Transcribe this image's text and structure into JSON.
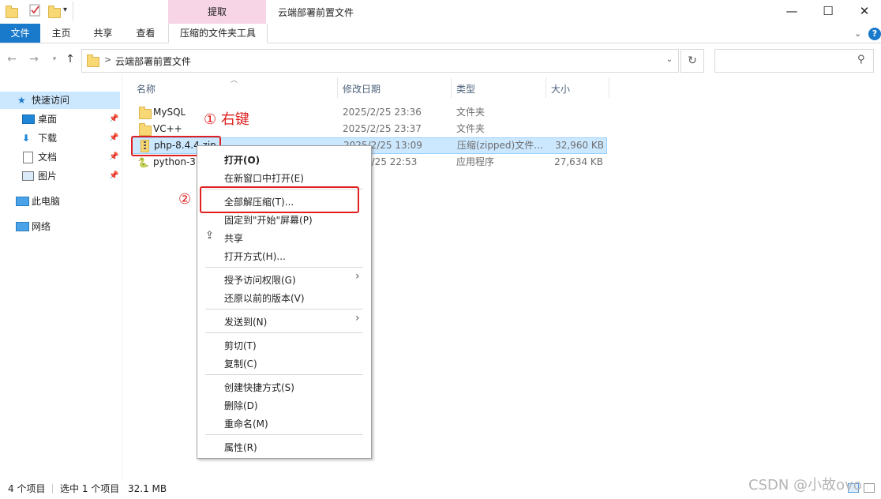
{
  "window": {
    "title": "云端部署前置文件",
    "ctx_tab_group": "提取",
    "minimize": "—",
    "maximize": "☐",
    "close": "✕"
  },
  "ribbon": {
    "tabs": [
      "文件",
      "主页",
      "共享",
      "查看",
      "压缩的文件夹工具"
    ],
    "help": "?"
  },
  "address": {
    "path": "云端部署前置文件",
    "separator": ">",
    "search_placeholder": ""
  },
  "sidebar": {
    "quick_access": "快速访问",
    "items": [
      "桌面",
      "下载",
      "文档",
      "图片"
    ],
    "this_pc": "此电脑",
    "network": "网络"
  },
  "columns": [
    "名称",
    "修改日期",
    "类型",
    "大小"
  ],
  "files": [
    {
      "name": "MySQL",
      "date": "2025/2/25 23:36",
      "type": "文件夹",
      "size": ""
    },
    {
      "name": "VC++",
      "date": "2025/2/25 23:37",
      "type": "文件夹",
      "size": ""
    },
    {
      "name": "php-8.4.4.zip",
      "date": "2025/2/25 13:09",
      "type": "压缩(zipped)文件...",
      "size": "32,960 KB"
    },
    {
      "name": "python-3.",
      "date": "2/25 22:53",
      "type": "应用程序",
      "size": "27,634 KB"
    }
  ],
  "context_menu": {
    "items": [
      "打开(O)",
      "在新窗口中打开(E)",
      "全部解压缩(T)...",
      "固定到\"开始\"屏幕(P)",
      "共享",
      "打开方式(H)...",
      "授予访问权限(G)",
      "还原以前的版本(V)",
      "发送到(N)",
      "剪切(T)",
      "复制(C)",
      "创建快捷方式(S)",
      "删除(D)",
      "重命名(M)",
      "属性(R)"
    ]
  },
  "annotations": {
    "step1": "① 右键",
    "step2": "②"
  },
  "status": {
    "count": "4 个项目",
    "selected": "选中 1 个项目",
    "size": "32.1 MB"
  },
  "watermark": "CSDN @小故ovo"
}
